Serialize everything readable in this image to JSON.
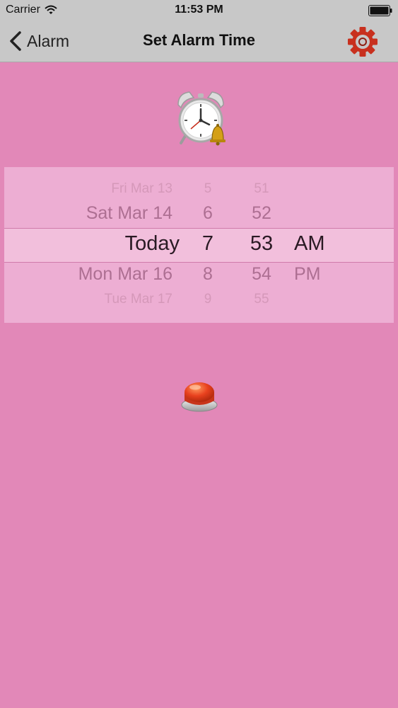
{
  "status_bar": {
    "carrier": "Carrier",
    "time": "11:53 PM",
    "wifi_icon": "wifi-icon",
    "battery_icon": "battery-icon"
  },
  "nav": {
    "back_label": "Alarm",
    "back_icon": "chevron-left-icon",
    "title": "Set Alarm Time",
    "settings_icon": "gear-icon"
  },
  "picker": {
    "rows": [
      {
        "date": "Fri Mar 13",
        "hour": "5",
        "minute": "51",
        "ampm": ""
      },
      {
        "date": "Sat Mar 14",
        "hour": "6",
        "minute": "52",
        "ampm": ""
      },
      {
        "date": "Today",
        "hour": "7",
        "minute": "53",
        "ampm": "AM"
      },
      {
        "date": "Mon Mar 16",
        "hour": "8",
        "minute": "54",
        "ampm": "PM"
      },
      {
        "date": "Tue Mar 17",
        "hour": "9",
        "minute": "55",
        "ampm": ""
      }
    ],
    "selected_index": 2
  },
  "icons": {
    "clock": "alarm-clock-icon",
    "alarm_button": "red-push-button-icon"
  },
  "colors": {
    "background": "#e288b8",
    "bar": "#c8c8c8",
    "gear": "#c8301e",
    "button_red": "#e8411e"
  }
}
